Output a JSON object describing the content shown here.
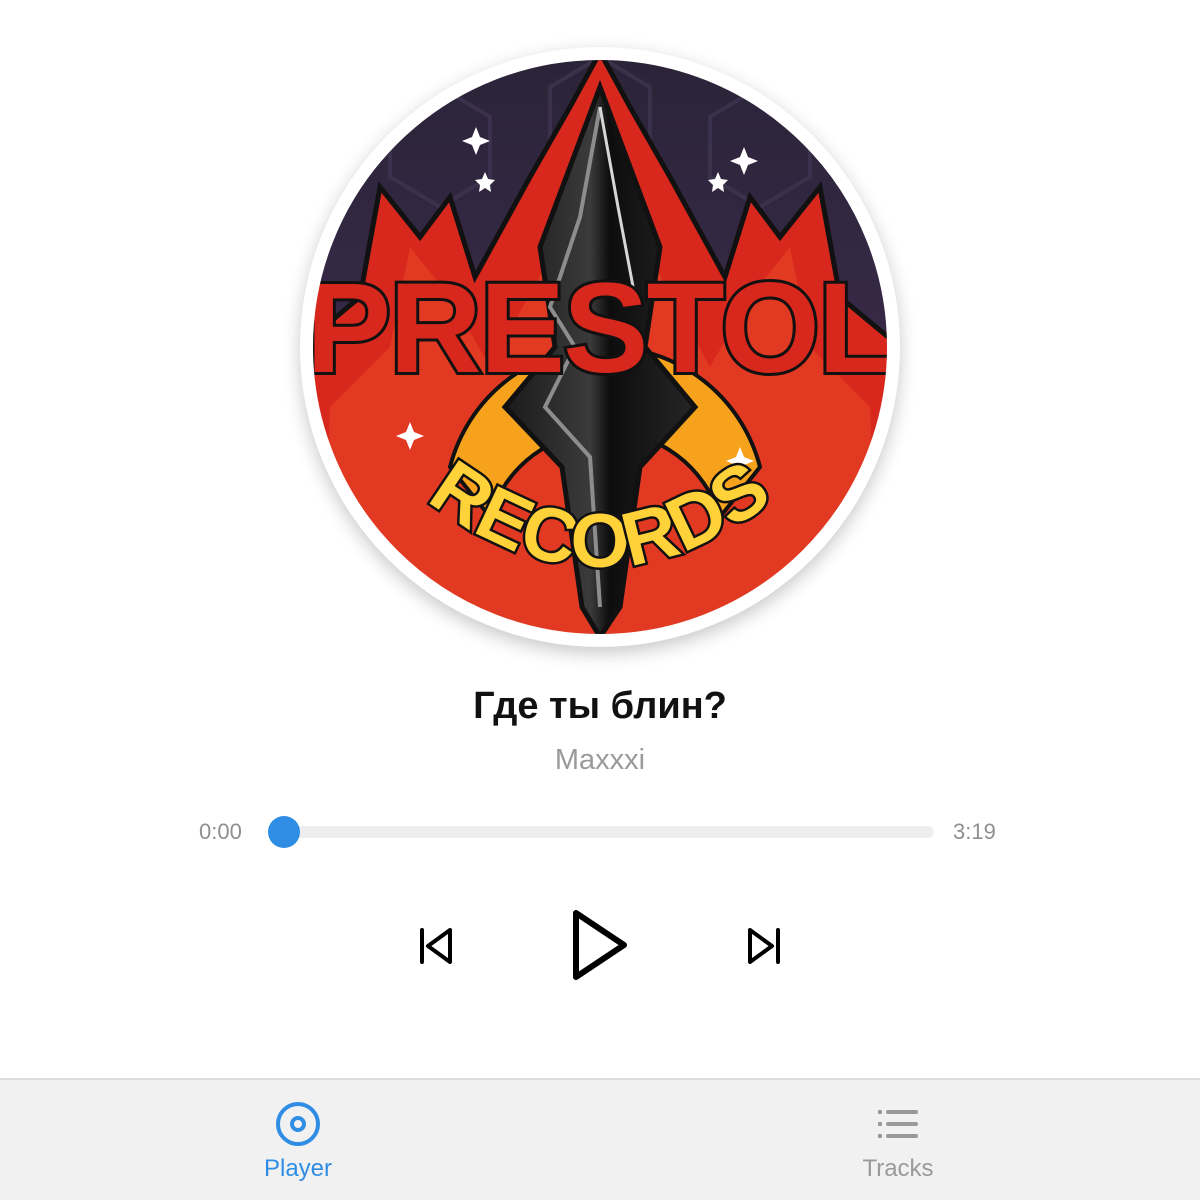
{
  "cover": {
    "logo_line1": "PRESTOL",
    "logo_line2": "RECORDS"
  },
  "track": {
    "title": "Где ты блин?",
    "artist": "Maxxxi"
  },
  "progress": {
    "current_time": "0:00",
    "total_time": "3:19",
    "fraction": 0.0
  },
  "controls": {
    "previous_icon": "skip-previous-icon",
    "play_icon": "play-icon",
    "next_icon": "skip-next-icon"
  },
  "bottom_nav": {
    "items": [
      {
        "label": "Player",
        "icon": "disc-icon",
        "active": true
      },
      {
        "label": "Tracks",
        "icon": "list-icon",
        "active": false
      }
    ]
  },
  "colors": {
    "accent": "#2f8de4",
    "inactive": "#9a9a9a",
    "nav_background": "#f1f1f1"
  }
}
